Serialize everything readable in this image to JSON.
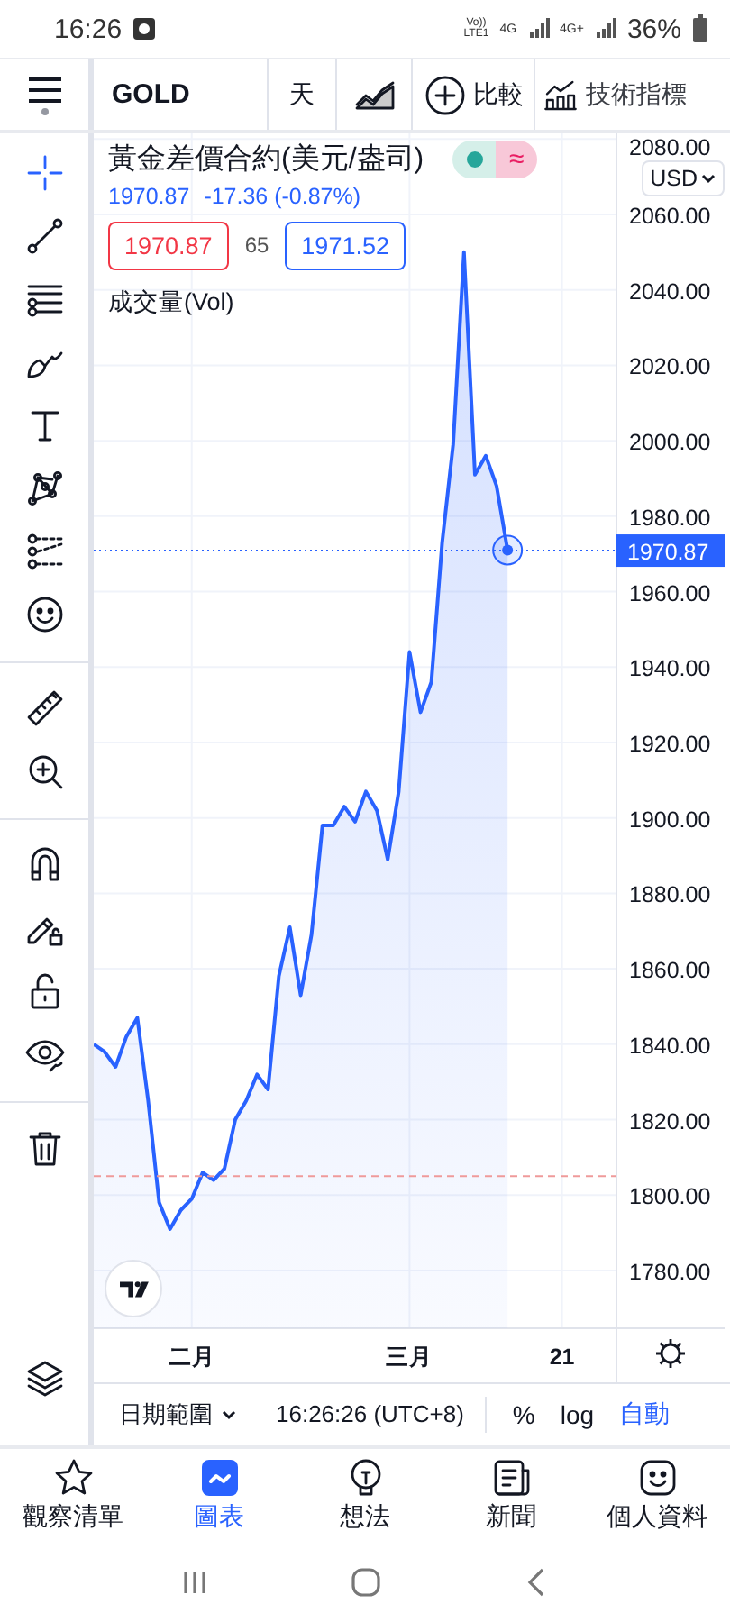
{
  "status_bar": {
    "time": "16:26",
    "volte_top": "Vo))",
    "volte_bottom": "LTE1",
    "network_1": "4G",
    "network_2": "4G+",
    "battery": "36%"
  },
  "toolbar": {
    "symbol": "GOLD",
    "interval": "天",
    "compare": "比較",
    "indicators": "技術指標"
  },
  "tool_groups": [
    {
      "tools": [
        {
          "selected": true
        },
        {
          "selected": false
        },
        {
          "selected": false
        },
        {
          "selected": false
        },
        {
          "selected": false
        },
        {
          "selected": false
        },
        {
          "selected": false
        },
        {
          "selected": false
        }
      ]
    },
    {
      "tools": [
        {
          "selected": false
        },
        {
          "selected": false
        }
      ]
    },
    {
      "tools": [
        {
          "selected": false
        },
        {
          "selected": false
        },
        {
          "selected": false
        },
        {
          "selected": false
        }
      ]
    },
    {
      "tools": [
        {
          "selected": false
        }
      ]
    }
  ],
  "legend": {
    "title": "黃金差價合約(美元/盎司)",
    "price": "1970.87",
    "change": "-17.36 (-0.87%)",
    "sell": "1970.87",
    "spread": "65",
    "buy": "1971.52",
    "indicator": "成交量(Vol)",
    "approx_symbol": "≈"
  },
  "currency": "USD",
  "chart": {
    "last_price_label": "1970.87",
    "chart_data": {
      "type": "area",
      "grid": true,
      "categories": [
        null,
        null,
        null,
        null,
        null,
        null,
        null,
        null,
        null,
        "二月",
        null,
        null,
        null,
        null,
        null,
        null,
        null,
        null,
        null,
        null,
        null,
        null,
        null,
        null,
        null,
        null,
        null,
        null,
        null,
        "三月",
        null,
        null,
        null,
        null,
        null,
        null,
        null,
        null,
        null,
        null,
        null,
        null,
        null,
        "21",
        null,
        null,
        null,
        null,
        null
      ],
      "series": [
        {
          "color": "#2962ff",
          "values": [
            1840,
            1838,
            1834,
            1842,
            1847,
            1825,
            1798,
            1791,
            1796,
            1799,
            1806,
            1804,
            1807,
            1820,
            1825,
            1832,
            1828,
            1858,
            1871,
            1853,
            1869,
            1898,
            1898,
            1903,
            1899,
            1907,
            1902,
            1889,
            1907,
            1944,
            1928,
            1936,
            1973,
            1999,
            2050,
            1991,
            1996,
            1988,
            1971,
            null,
            null,
            null,
            null,
            null,
            null,
            null,
            null,
            null,
            null
          ]
        }
      ],
      "ylim": [
        1764.7,
        2081.5
      ],
      "yticks": [
        {
          "value": 1780,
          "label": "1780.00"
        },
        {
          "value": 1800,
          "label": "1800.00"
        },
        {
          "value": 1820,
          "label": "1820.00"
        },
        {
          "value": 1840,
          "label": "1840.00"
        },
        {
          "value": 1860,
          "label": "1860.00"
        },
        {
          "value": 1880,
          "label": "1880.00"
        },
        {
          "value": 1900,
          "label": "1900.00"
        },
        {
          "value": 1920,
          "label": "1920.00"
        },
        {
          "value": 1940,
          "label": "1940.00"
        },
        {
          "value": 1960,
          "label": "1960.00"
        },
        {
          "value": 1980,
          "label": "1980.00"
        },
        {
          "value": 2000,
          "label": "2000.00"
        },
        {
          "value": 2020,
          "label": "2020.00"
        },
        {
          "value": 2040,
          "label": "2040.00"
        },
        {
          "value": 2060,
          "label": "2060.00"
        },
        {
          "value": 2080,
          "label": "2080.00"
        }
      ],
      "ref_lines": [
        {
          "axis": "y",
          "value": 1970.87,
          "color": "#2962ff"
        },
        {
          "axis": "y",
          "value": 1805,
          "color": "#ef9a9a"
        }
      ]
    }
  },
  "bottom_bar": {
    "date_range": "日期範圍",
    "clock": "16:26:26 (UTC+8)",
    "scale_options": [
      {
        "label": "%",
        "selected": false
      },
      {
        "label": "log",
        "selected": false
      },
      {
        "label": "自動",
        "selected": true
      }
    ]
  },
  "nav": [
    {
      "label": "觀察清單",
      "selected": false
    },
    {
      "label": "圖表",
      "selected": true
    },
    {
      "label": "想法",
      "selected": false
    },
    {
      "label": "新聞",
      "selected": false
    },
    {
      "label": "個人資料",
      "selected": false
    }
  ]
}
